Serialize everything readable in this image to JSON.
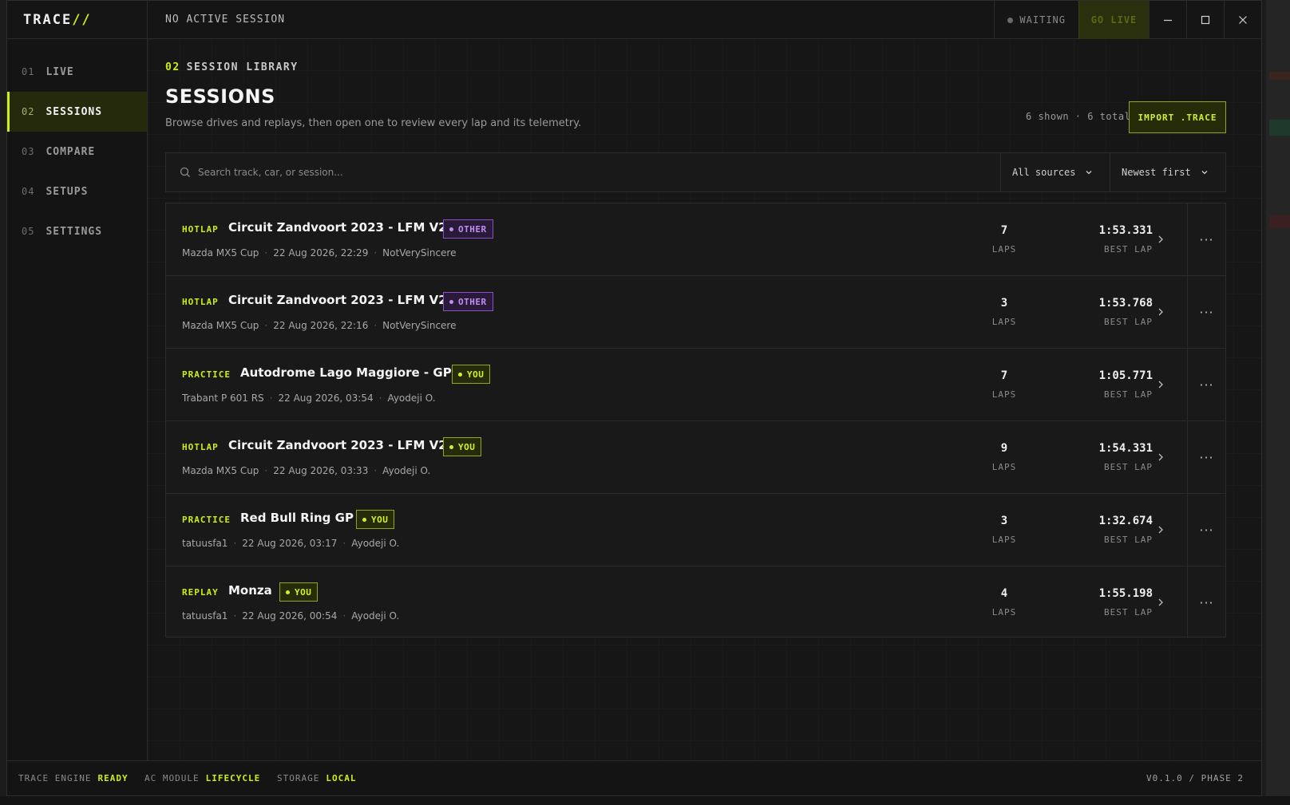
{
  "app": {
    "logo_text": "TRACE",
    "logo_mark": "//",
    "session_status": "NO ACTIVE SESSION",
    "connection_status": "WAITING",
    "go_live_label": "GO LIVE"
  },
  "window_controls": {
    "minimize": "—",
    "maximize": "☐",
    "close": "✕"
  },
  "sidebar": {
    "items": [
      {
        "num": "01",
        "label": "LIVE"
      },
      {
        "num": "02",
        "label": "SESSIONS"
      },
      {
        "num": "03",
        "label": "COMPARE"
      },
      {
        "num": "04",
        "label": "SETUPS"
      },
      {
        "num": "05",
        "label": "SETTINGS"
      }
    ],
    "active": "SESSIONS"
  },
  "header": {
    "section_num": "02",
    "section_label": "SESSION LIBRARY",
    "title": "SESSIONS",
    "subtitle": "Browse drives and replays, then open one to review every lap and its telemetry.",
    "counts": "6 shown · 6 total",
    "import_label": "IMPORT .TRACE"
  },
  "filters": {
    "search_placeholder": "Search track, car, or session...",
    "source_value": "All sources",
    "sort_value": "Newest first"
  },
  "sessions": [
    {
      "type": "HOTLAP",
      "track": "Circuit Zandvoort 2023 - LFM V2",
      "badge": "OTHER",
      "car": "Mazda MX5 Cup",
      "date": "22 Aug 2026, 22:29",
      "driver": "NotVerySincere",
      "laps": "7",
      "laps_label": "LAPS",
      "best": "1:53.331",
      "best_label": "BEST LAP"
    },
    {
      "type": "HOTLAP",
      "track": "Circuit Zandvoort 2023 - LFM V2",
      "badge": "OTHER",
      "car": "Mazda MX5 Cup",
      "date": "22 Aug 2026, 22:16",
      "driver": "NotVerySincere",
      "laps": "3",
      "laps_label": "LAPS",
      "best": "1:53.768",
      "best_label": "BEST LAP"
    },
    {
      "type": "PRACTICE",
      "track": "Autodrome Lago Maggiore - GP",
      "badge": "YOU",
      "car": "Trabant P 601 RS",
      "date": "22 Aug 2026, 03:54",
      "driver": "Ayodeji O.",
      "laps": "7",
      "laps_label": "LAPS",
      "best": "1:05.771",
      "best_label": "BEST LAP"
    },
    {
      "type": "HOTLAP",
      "track": "Circuit Zandvoort 2023 - LFM V2",
      "badge": "YOU",
      "car": "Mazda MX5 Cup",
      "date": "22 Aug 2026, 03:33",
      "driver": "Ayodeji O.",
      "laps": "9",
      "laps_label": "LAPS",
      "best": "1:54.331",
      "best_label": "BEST LAP"
    },
    {
      "type": "PRACTICE",
      "track": "Red Bull Ring GP",
      "badge": "YOU",
      "car": "tatuusfa1",
      "date": "22 Aug 2026, 03:17",
      "driver": "Ayodeji O.",
      "laps": "3",
      "laps_label": "LAPS",
      "best": "1:32.674",
      "best_label": "BEST LAP"
    },
    {
      "type": "REPLAY",
      "track": "Monza",
      "badge": "YOU",
      "car": "tatuusfa1",
      "date": "22 Aug 2026, 00:54",
      "driver": "Ayodeji O.",
      "laps": "4",
      "laps_label": "LAPS",
      "best": "1:55.198",
      "best_label": "BEST LAP"
    }
  ],
  "statusbar": {
    "engine_label": "TRACE ENGINE",
    "engine_value": "READY",
    "module_label": "AC MODULE",
    "module_value": "LIFECYCLE",
    "storage_label": "STORAGE",
    "storage_value": "LOCAL",
    "version": "V0.1.0 / PHASE 2"
  },
  "colors": {
    "accent": "#c8f018",
    "other_badge": "#c08ef0",
    "background": "#141414"
  }
}
